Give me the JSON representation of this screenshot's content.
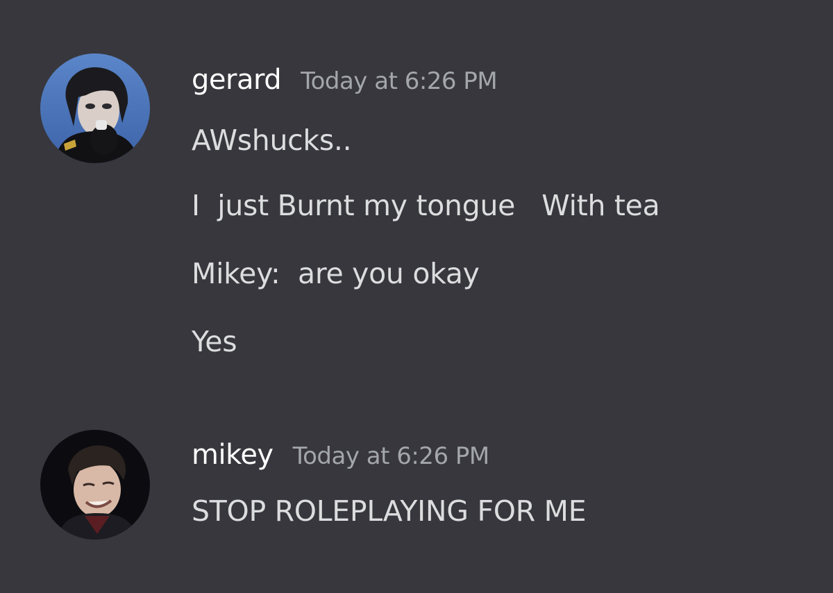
{
  "messages": [
    {
      "username": "gerard",
      "timestamp": "Today at 6:26 PM",
      "lines": [
        "AWshucks..",
        "I  just Burnt my tongue   With tea",
        "Mikey:  are you okay",
        "Yes"
      ]
    },
    {
      "username": "mikey",
      "timestamp": "Today at 6:26 PM",
      "lines": [
        "STOP ROLEPLAYING FOR ME"
      ]
    }
  ],
  "colors": {
    "background": "#37373d",
    "username": "#ffffff",
    "timestamp": "#a3a6aa",
    "message_text": "#dcddde"
  }
}
